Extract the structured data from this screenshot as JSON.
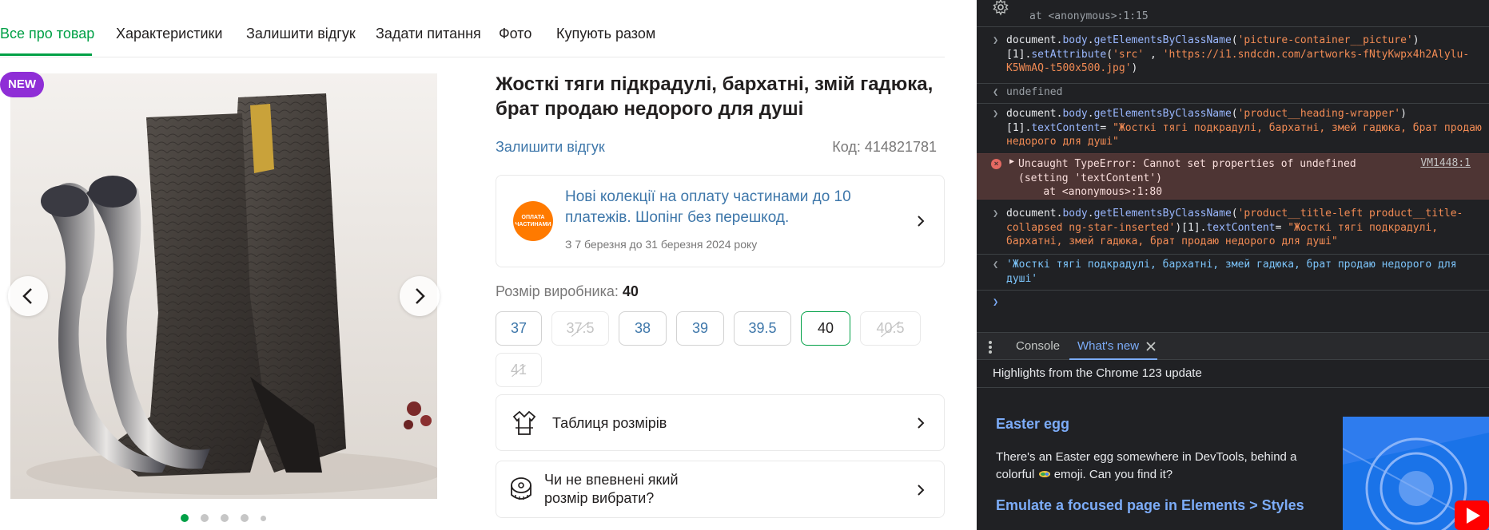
{
  "tabs": [
    "Все про товар",
    "Характеристики",
    "Залишити відгук",
    "Задати питання",
    "Фото",
    "Купують разом"
  ],
  "gallery": {
    "badge": "NEW",
    "dots": 5,
    "active_dot": 1
  },
  "product": {
    "title": "Жосткі тяги підкрадулі, бархатні, змій гадюка, брат продаю недорого для душі",
    "review_link": "Залишити відгук",
    "code": "Код: 414821781"
  },
  "promo": {
    "logo_text": "ОПЛАТА ЧАСТИНАМИ",
    "text": "Нові колекції на оплату частинами до 10 платежів. Шопінг без перешкод.",
    "dates": "З 7 березня до 31 березня 2024 року"
  },
  "sizes": {
    "label": "Розмір виробника:",
    "selected_value": "40",
    "options": [
      {
        "label": "37",
        "state": "available"
      },
      {
        "label": "37.5",
        "state": "disabled"
      },
      {
        "label": "38",
        "state": "available"
      },
      {
        "label": "39",
        "state": "available"
      },
      {
        "label": "39.5",
        "state": "available"
      },
      {
        "label": "40",
        "state": "selected"
      },
      {
        "label": "40.5",
        "state": "disabled"
      },
      {
        "label": "41",
        "state": "disabled"
      }
    ]
  },
  "size_table": {
    "label": "Таблиця розмірів"
  },
  "size_help": {
    "line1": "Чи не впевнені який",
    "line2": "розмір вибрати?"
  },
  "devtools": {
    "truncated_top": "at <anonymous>:1:15",
    "cmd1_a": "document.",
    "cmd1_b": "body",
    "cmd1_c": ".",
    "cmd1_d": "getElementsByClassName",
    "cmd1_e": "(",
    "cmd1_str": "'picture-container__picture'",
    "cmd1_f": ")",
    "cmd1_g": "[1].",
    "cmd1_h": "setAttribute",
    "cmd1_i": "(",
    "cmd1_str2": "'src'",
    "cmd1_j": " , ",
    "cmd1_str3": "'https://i1.sndcdn.com/artworks-fNtyKwpx4h2Alylu-K5WmAQ-t500x500.jpg'",
    "cmd1_k": ")",
    "out1": "undefined",
    "cmd2_str": "'product__heading-wrapper'",
    "cmd2_g": "[1].",
    "cmd2_h": "textContent",
    "cmd2_eq": "= ",
    "cmd2_val": "\"Жосткі тягі подкрадулі, бархатні, змей гадюка, брат продаю недорого для душі\"",
    "error_text": "Uncaught TypeError: Cannot set properties of undefined\n(setting 'textContent')\n    at <anonymous>:1:80",
    "error_link": "VM1448:1",
    "cmd3_str": "'product__title-left product__title-collapsed ng-star-inserted'",
    "cmd3_val": "\"Жосткі тягі подкрадулі, бархатні, змей гадюка, брат продаю недорого для душі\"",
    "result": "'Жосткі тягі подкрадулі, бархатні, змей гадюка, брат продаю недорого для душі'",
    "drawer_tabs": [
      "Console",
      "What's new"
    ],
    "whatsnew_header": "Highlights from the Chrome 123 update",
    "egg_title": "Easter egg",
    "egg_text_1": "There's an Easter egg somewhere in DevTools, behind a",
    "egg_text_2a": "colorful",
    "egg_text_2b": "emoji. Can you find it?",
    "emu_title": "Emulate a focused page in Elements > Styles"
  },
  "colors": {
    "accent_green": "#00a046",
    "link_blue": "#3e77aa",
    "badge_purple": "#8f2ed6",
    "devtools_bg": "#202124"
  },
  "icons": [
    "chevron-left-icon",
    "chevron-right-icon",
    "settings-gear-icon",
    "size-table-icon",
    "measuring-tape-icon",
    "close-icon",
    "kebab-menu-icon",
    "error-icon"
  ]
}
